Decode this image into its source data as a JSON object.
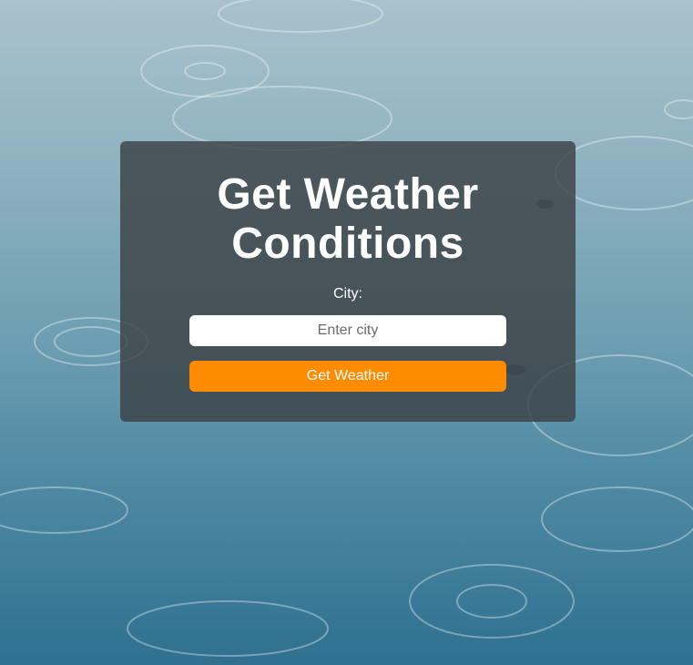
{
  "page": {
    "background": "rain ripples on water"
  },
  "form": {
    "title_line1": "Get Weather",
    "title_line2": "Conditions",
    "city_label": "City:",
    "city_placeholder": "Enter city",
    "city_value": "",
    "submit_label": "Get Weather"
  },
  "colors": {
    "panel": "#3c4244",
    "button": "#ff8c00",
    "text": "#ffffff"
  }
}
